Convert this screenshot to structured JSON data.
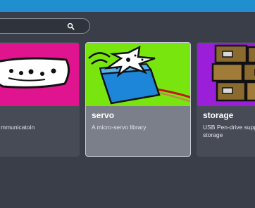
{
  "search": {
    "placeholder": ""
  },
  "cards": [
    {
      "name": "",
      "description": "mmunicatoin",
      "thumb_color": "#e0148f"
    },
    {
      "name": "servo",
      "description": "A micro-servo library",
      "thumb_color": "#78e60e"
    },
    {
      "name": "storage",
      "description": "USB Pen-drive supp storage",
      "thumb_color": "#9b1fd8"
    }
  ],
  "colors": {
    "topbar": "#1f8fcf",
    "background": "#3a3e48",
    "card": "#474b55",
    "card_selected": "#7a7f89"
  }
}
